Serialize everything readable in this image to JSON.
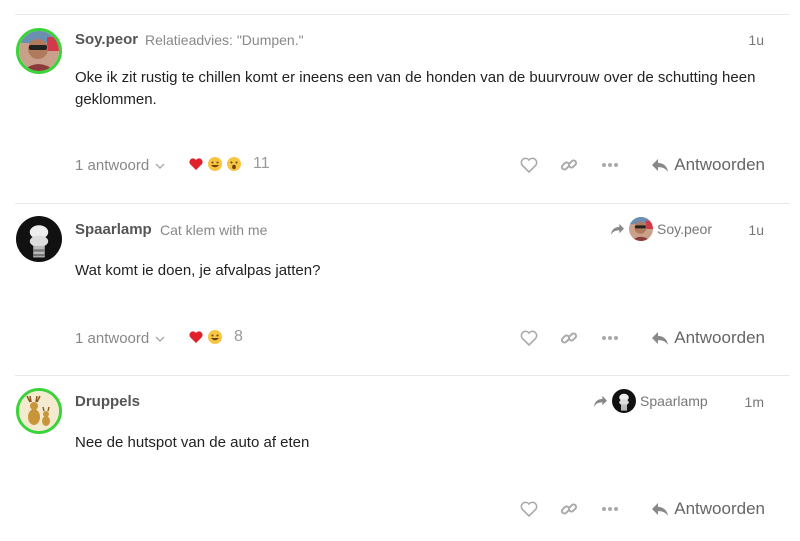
{
  "posts": [
    {
      "username": "Soy.peor",
      "title": "Relatieadvies: \"Dumpen.\"",
      "time": "1u",
      "body": "Oke ik zit rustig te chillen komt er ineens een van de honden van de buurvrouw over de schutting heen geklommen.",
      "replies": "1 antwoord",
      "reaction_count": "11",
      "reply_label": "Antwoorden"
    },
    {
      "username": "Spaarlamp",
      "title": "Cat klem with me",
      "reply_to": "Soy.peor",
      "time": "1u",
      "body": "Wat komt ie doen, je afvalpas jatten?",
      "replies": "1 antwoord",
      "reaction_count": "8",
      "reply_label": "Antwoorden"
    },
    {
      "username": "Druppels",
      "reply_to": "Spaarlamp",
      "time": "1m",
      "body": "Nee de hutspot van de auto af eten",
      "reply_label": "Antwoorden"
    }
  ],
  "colors": {
    "ring": "#3ad43a",
    "muted": "#888888",
    "divider": "#e9e9e9"
  },
  "icons": [
    "heart-icon",
    "link-icon",
    "more-icon",
    "reply-arrow-icon",
    "chevron-down-icon",
    "share-arrow-icon"
  ]
}
